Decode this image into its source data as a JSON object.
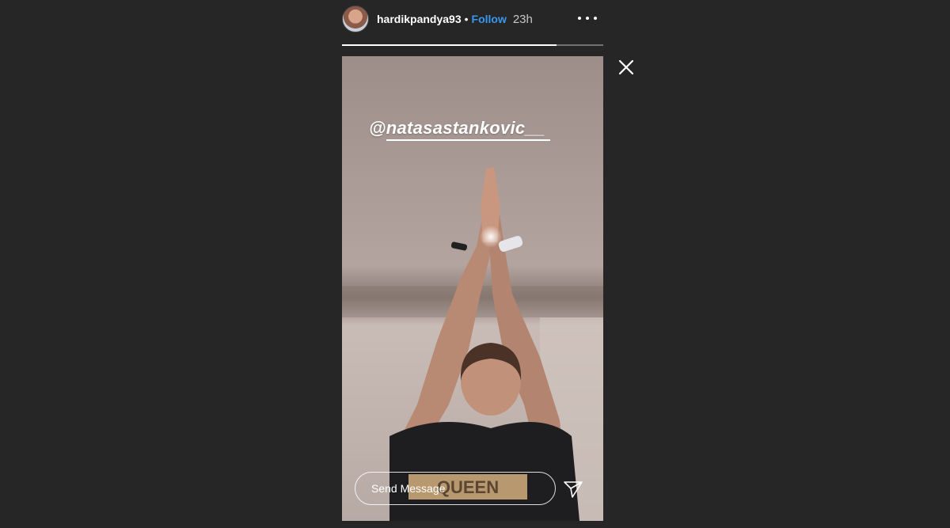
{
  "header": {
    "username": "hardikpandya93",
    "separator": "•",
    "follow_label": "Follow",
    "timestamp": "23h"
  },
  "progress": {
    "fraction": 0.82
  },
  "story": {
    "mention": "@natasastankovic__",
    "shirt_text": "QUEEN"
  },
  "reply": {
    "placeholder": "Send Message"
  },
  "icons": {
    "more": "more-options-icon",
    "close": "close-icon",
    "send": "send-icon"
  },
  "colors": {
    "background": "#262626",
    "follow": "#3897f0",
    "text": "#ffffff"
  }
}
